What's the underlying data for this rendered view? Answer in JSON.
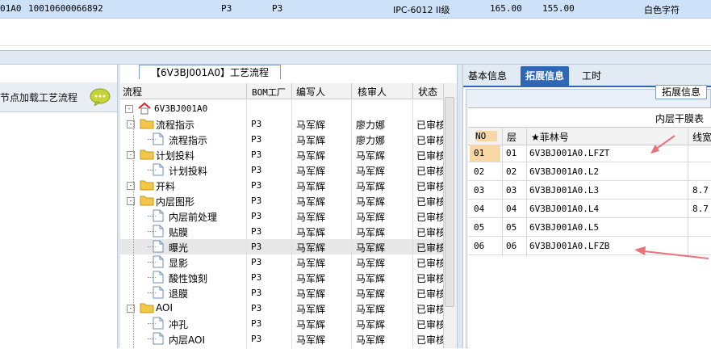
{
  "top_row": {
    "id": "01A0",
    "code": "10010600066892",
    "c1": "P3",
    "c2": "P3",
    "spec": "IPC-6012 II级",
    "v1": "165.00",
    "v2": "155.00",
    "text": "白色字符"
  },
  "left_panel": {
    "title": "节点加载工艺流程"
  },
  "middle_panel": {
    "tab_label": "【6V3BJ001A0】工艺流程",
    "columns": [
      "流程",
      "BOM工厂",
      "编写人",
      "核审人",
      "状态"
    ],
    "rows": [
      {
        "name": "6V3BJ001A0",
        "bom": "",
        "writer": "",
        "reviewer": "",
        "status": "",
        "level": 0,
        "icon": "home-icon"
      },
      {
        "name": "流程指示",
        "bom": "P3",
        "writer": "马军辉",
        "reviewer": "廖力娜",
        "status": "已审核",
        "level": 1,
        "icon": "folder-icon"
      },
      {
        "name": "流程指示",
        "bom": "P3",
        "writer": "马军辉",
        "reviewer": "廖力娜",
        "status": "已审核",
        "level": 2,
        "icon": "document-icon"
      },
      {
        "name": "计划投料",
        "bom": "P3",
        "writer": "马军辉",
        "reviewer": "马军辉",
        "status": "已审核",
        "level": 1,
        "icon": "folder-icon"
      },
      {
        "name": "计划投料",
        "bom": "P3",
        "writer": "马军辉",
        "reviewer": "马军辉",
        "status": "已审核",
        "level": 2,
        "icon": "document-icon"
      },
      {
        "name": "开料",
        "bom": "P3",
        "writer": "马军辉",
        "reviewer": "马军辉",
        "status": "已审核",
        "level": 1,
        "icon": "folder-icon"
      },
      {
        "name": "内层图形",
        "bom": "P3",
        "writer": "马军辉",
        "reviewer": "马军辉",
        "status": "已审核",
        "level": 1,
        "icon": "folder-icon"
      },
      {
        "name": "内层前处理",
        "bom": "P3",
        "writer": "马军辉",
        "reviewer": "马军辉",
        "status": "已审核",
        "level": 2,
        "icon": "document-icon"
      },
      {
        "name": "贴膜",
        "bom": "P3",
        "writer": "马军辉",
        "reviewer": "马军辉",
        "status": "已审核",
        "level": 2,
        "icon": "document-icon"
      },
      {
        "name": "曝光",
        "bom": "P3",
        "writer": "马军辉",
        "reviewer": "马军辉",
        "status": "已审核",
        "level": 2,
        "icon": "document-icon",
        "selected": true
      },
      {
        "name": "显影",
        "bom": "P3",
        "writer": "马军辉",
        "reviewer": "马军辉",
        "status": "已审核",
        "level": 2,
        "icon": "document-icon"
      },
      {
        "name": "酸性蚀刻",
        "bom": "P3",
        "writer": "马军辉",
        "reviewer": "马军辉",
        "status": "已审核",
        "level": 2,
        "icon": "document-icon"
      },
      {
        "name": "退膜",
        "bom": "P3",
        "writer": "马军辉",
        "reviewer": "马军辉",
        "status": "已审核",
        "level": 2,
        "icon": "document-icon"
      },
      {
        "name": "AOI",
        "bom": "P3",
        "writer": "马军辉",
        "reviewer": "马军辉",
        "status": "已审核",
        "level": 1,
        "icon": "folder-icon"
      },
      {
        "name": "冲孔",
        "bom": "P3",
        "writer": "马军辉",
        "reviewer": "马军辉",
        "status": "已审核",
        "level": 2,
        "icon": "document-icon"
      },
      {
        "name": "内层AOI",
        "bom": "P3",
        "writer": "马军辉",
        "reviewer": "马军辉",
        "status": "已审核",
        "level": 2,
        "icon": "document-icon"
      }
    ]
  },
  "right_panel": {
    "tabs": [
      "基本信息",
      "拓展信息",
      "工时"
    ],
    "active_tab": 1,
    "group_label": "拓展信息",
    "grid_title": "内层干膜表",
    "columns": [
      "NO",
      "层",
      "★菲林号",
      "线宽"
    ],
    "rows": [
      {
        "no": "01",
        "layer": "01",
        "film": "6V3BJ001A0.LFZT",
        "width": "",
        "selected": true
      },
      {
        "no": "02",
        "layer": "02",
        "film": "6V3BJ001A0.L2",
        "width": ""
      },
      {
        "no": "03",
        "layer": "03",
        "film": "6V3BJ001A0.L3",
        "width": "8.7"
      },
      {
        "no": "04",
        "layer": "04",
        "film": "6V3BJ001A0.L4",
        "width": "8.7"
      },
      {
        "no": "05",
        "layer": "05",
        "film": "6V3BJ001A0.L5",
        "width": ""
      },
      {
        "no": "06",
        "layer": "06",
        "film": "6V3BJ001A0.LFZB",
        "width": ""
      }
    ]
  },
  "colors": {
    "selection_blue": "#cde2f9",
    "tab_active": "#2f67b5",
    "annotation_arrow": "#e8737b",
    "folder": "#f3c64a",
    "selected_no": "#f8d7a5"
  }
}
